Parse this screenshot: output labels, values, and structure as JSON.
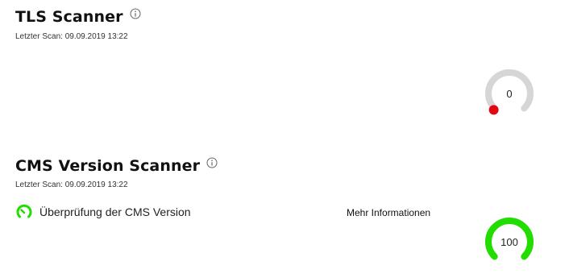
{
  "tls": {
    "title": "TLS Scanner",
    "last_scan": "Letzter Scan: 09.09.2019 13:22",
    "score": "0",
    "score_value": 0,
    "color": "#e30613",
    "track_color": "#d6d6d6"
  },
  "cms": {
    "title": "CMS Version Scanner",
    "last_scan": "Letzter Scan: 09.09.2019 13:22",
    "check_label": "Überprüfung der CMS Version",
    "more_info": "Mehr Informationen",
    "score": "100",
    "score_value": 100,
    "color": "#22dd00",
    "track_color": "#d6d6d6"
  },
  "icons": {
    "info": "info-icon",
    "check": "gauge-check-icon"
  }
}
